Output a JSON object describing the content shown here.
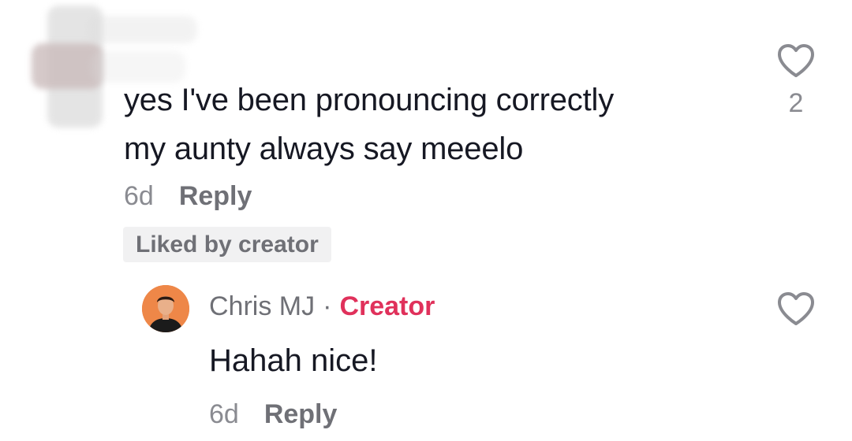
{
  "comment": {
    "text": "yes I've been pronouncing correctly\nmy aunty always say meeelo",
    "time": "6d",
    "reply_label": "Reply",
    "like_count": "2",
    "liked_badge": "Liked by creator"
  },
  "reply": {
    "author": "Chris MJ",
    "separator": "·",
    "author_tag": "Creator",
    "text": "Hahah nice!",
    "time": "6d",
    "reply_label": "Reply"
  },
  "colors": {
    "creator_accent": "#e0315b",
    "text_primary": "#161823",
    "text_secondary": "#8a8b91"
  },
  "icons": {
    "like": "heart-outline-icon"
  }
}
